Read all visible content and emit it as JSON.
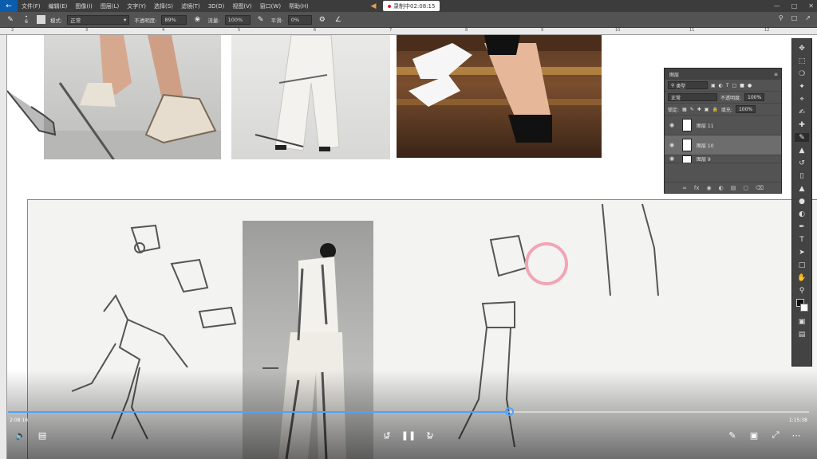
{
  "menubar": {
    "app_icon": "photoshop-back-icon",
    "items": [
      "文件(F)",
      "编辑(E)",
      "图像(I)",
      "图层(L)",
      "文字(Y)",
      "选择(S)",
      "滤镜(T)",
      "3D(D)",
      "视图(V)",
      "窗口(W)",
      "帮助(H)"
    ],
    "recording_label": "录制中02:08:15",
    "recording_dot_color": "#e02020"
  },
  "options": {
    "brush_size": "6",
    "mode_label": "模式:",
    "mode_value": "正常",
    "opacity_label": "不透明度:",
    "opacity_value": "89%",
    "flow_label": "流量:",
    "flow_value": "100%",
    "smooth_label": "平滑:",
    "smooth_value": "0%"
  },
  "ruler": {
    "marks": [
      "2",
      "3",
      "4",
      "5",
      "6",
      "7",
      "8",
      "9",
      "10",
      "11",
      "12"
    ]
  },
  "layers_panel": {
    "title": "图层",
    "filter_type": "类型",
    "blend_mode": "正常",
    "opacity_label": "不透明度:",
    "opacity_value": "100%",
    "lock_label": "锁定:",
    "fill_label": "填充:",
    "fill_value": "100%",
    "layers": [
      {
        "name": "图层 11",
        "selected": false
      },
      {
        "name": "图层 10",
        "selected": true
      },
      {
        "name": "图层 9",
        "selected": false
      }
    ]
  },
  "tools": [
    "move-icon",
    "marquee-icon",
    "lasso-icon",
    "magic-wand-icon",
    "crop-icon",
    "eyedropper-icon",
    "healing-icon",
    "brush-icon",
    "stamp-icon",
    "history-brush-icon",
    "eraser-icon",
    "bucket-icon",
    "blur-icon",
    "dodge-icon",
    "pen-icon",
    "text-icon",
    "path-select-icon",
    "rectangle-icon",
    "hand-icon",
    "zoom-icon"
  ],
  "video": {
    "current_time": "2:08:16",
    "total_time": "1:15:38",
    "progress": 0.625,
    "rewind_seconds": "10",
    "forward_seconds": "30",
    "accent_color": "#4da3ff"
  }
}
